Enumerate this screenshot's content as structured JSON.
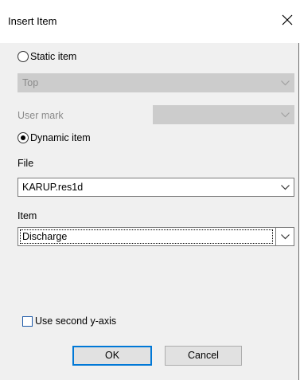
{
  "window": {
    "title": "Insert Item"
  },
  "static_item": {
    "label": "Static item",
    "selected": false,
    "position_value": "Top",
    "user_mark_label": "User mark",
    "user_mark_value": ""
  },
  "dynamic_item": {
    "label": "Dynamic item",
    "selected": true
  },
  "file": {
    "label": "File",
    "value": "KARUP.res1d"
  },
  "item": {
    "label": "Item",
    "value": "Discharge"
  },
  "second_axis": {
    "label": "Use second y-axis",
    "checked": false
  },
  "buttons": {
    "ok": "OK",
    "cancel": "Cancel"
  },
  "icons": {
    "close": "close-icon",
    "dropdown": "chevron-down-icon"
  },
  "colors": {
    "focus_border": "#0078d7",
    "checkbox_border": "#1e5aa8",
    "disabled_fill": "#cccccc"
  }
}
